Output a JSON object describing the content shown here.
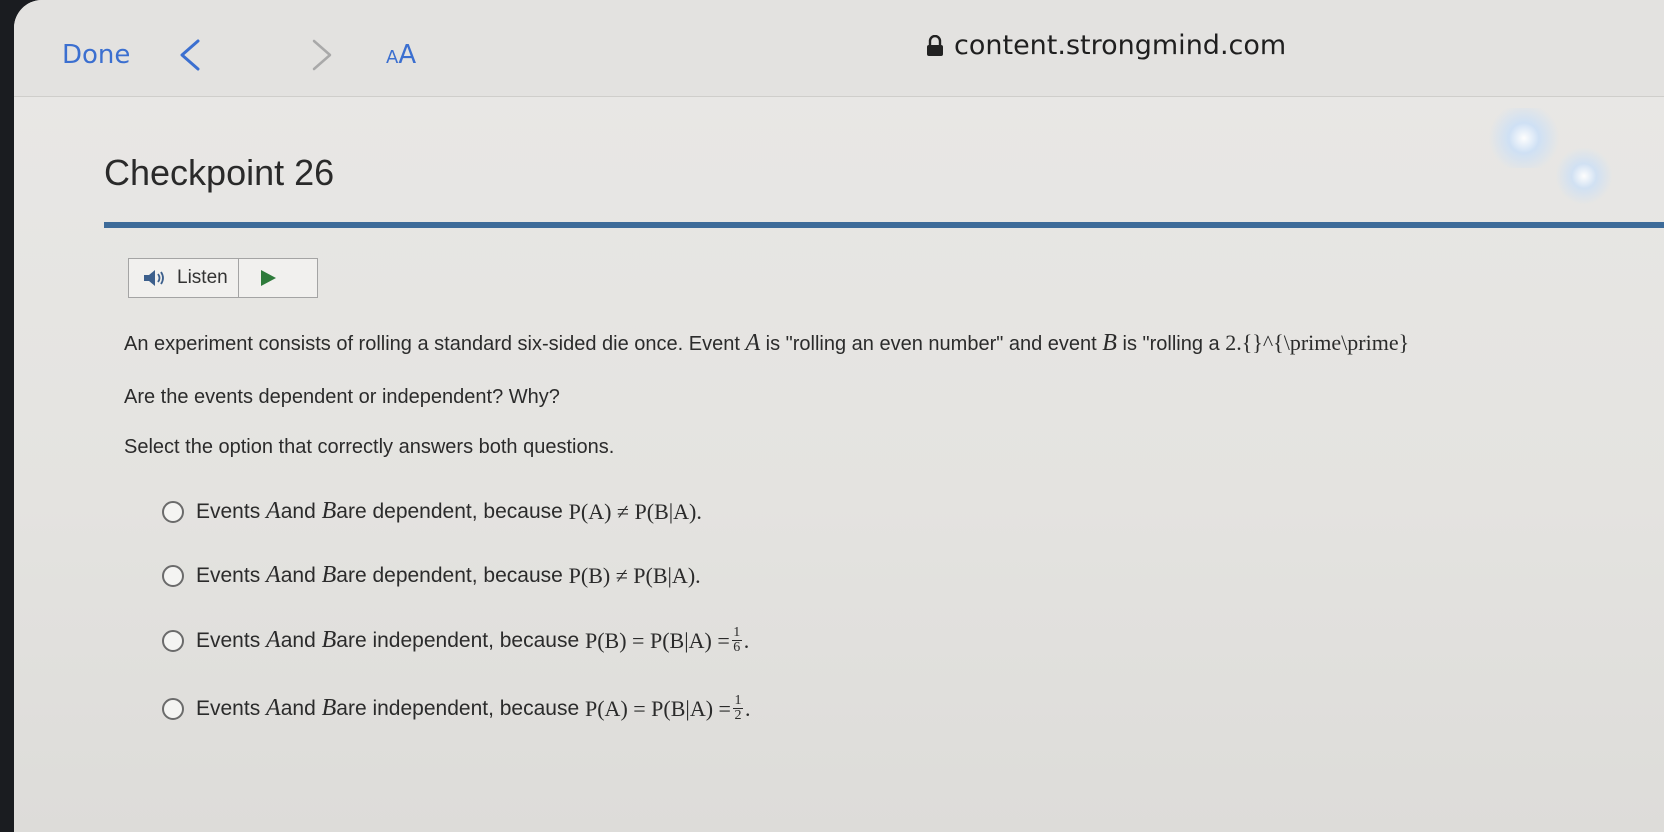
{
  "browser": {
    "done_label": "Done",
    "text_size_small": "A",
    "text_size_big": "A",
    "url": "content.strongmind.com"
  },
  "page": {
    "title": "Checkpoint 26",
    "listen_label": "Listen",
    "rule_color": "#3d6b99"
  },
  "question": {
    "line1_a": "An experiment consists of rolling a standard six-sided die once. Event ",
    "event_a": "A",
    "line1_b": " is \"rolling an even number\" and event ",
    "event_b": "B",
    "line1_c": " is \"rolling a ",
    "tex_residue": "2.{}^{\\prime\\prime}",
    "line2": "Are the events dependent or independent? Why?",
    "line3": "Select the option that correctly answers both questions."
  },
  "options": [
    {
      "prefix": "Events ",
      "mid": " and ",
      "suffix": " are dependent, because ",
      "formula": "P(A) ≠ P(B|A)."
    },
    {
      "prefix": "Events ",
      "mid": " and ",
      "suffix": " are dependent, because ",
      "formula": "P(B) ≠ P(B|A)."
    },
    {
      "prefix": "Events ",
      "mid": " and ",
      "suffix": " are independent, because ",
      "formula": "P(B) = P(B|A) = ",
      "frac_num": "1",
      "frac_den": "6",
      "end": "."
    },
    {
      "prefix": "Events ",
      "mid": " and ",
      "suffix": " are independent, because ",
      "formula": "P(A) = P(B|A) = ",
      "frac_num": "1",
      "frac_den": "2",
      "end": "."
    }
  ]
}
